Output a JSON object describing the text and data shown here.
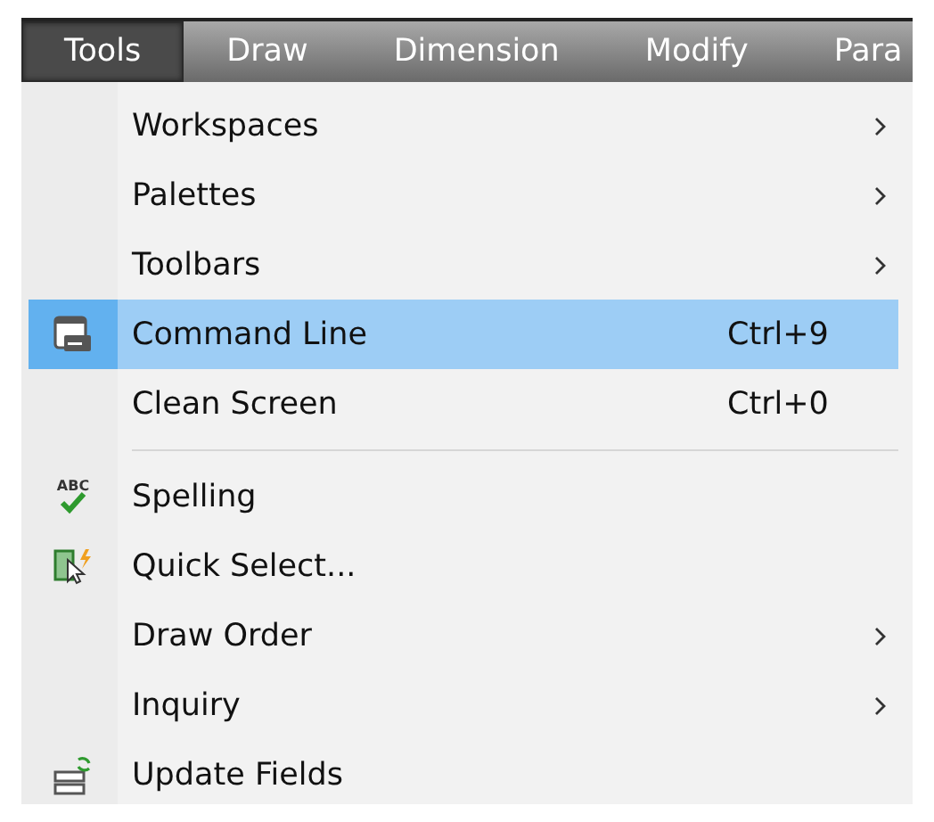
{
  "menubar": [
    {
      "label": "Tools",
      "selected": true
    },
    {
      "label": "Draw",
      "selected": false
    },
    {
      "label": "Dimension",
      "selected": false
    },
    {
      "label": "Modify",
      "selected": false
    },
    {
      "label": "Para",
      "selected": false
    }
  ],
  "menu": {
    "groups": [
      [
        {
          "label": "Workspaces",
          "has_submenu": true,
          "selected": false
        },
        {
          "label": "Palettes",
          "has_submenu": true,
          "selected": false
        },
        {
          "label": "Toolbars",
          "has_submenu": true,
          "selected": false
        },
        {
          "label": "Command Line",
          "kind": "window",
          "shortcut": "Ctrl+9",
          "has_submenu": false,
          "selected": true
        },
        {
          "label": "Clean Screen",
          "shortcut": "Ctrl+0",
          "has_submenu": false,
          "selected": false
        }
      ],
      [
        {
          "label": "Spelling",
          "kind": "spelling",
          "icon_text": "ABC",
          "has_submenu": false,
          "selected": false
        },
        {
          "label": "Quick Select...",
          "kind": "select",
          "has_submenu": false,
          "selected": false
        },
        {
          "label": "Draw Order",
          "has_submenu": true,
          "selected": false
        },
        {
          "label": "Inquiry",
          "has_submenu": true,
          "selected": false
        },
        {
          "label": "Update Fields",
          "kind": "fields",
          "has_submenu": false,
          "selected": false
        }
      ]
    ]
  }
}
